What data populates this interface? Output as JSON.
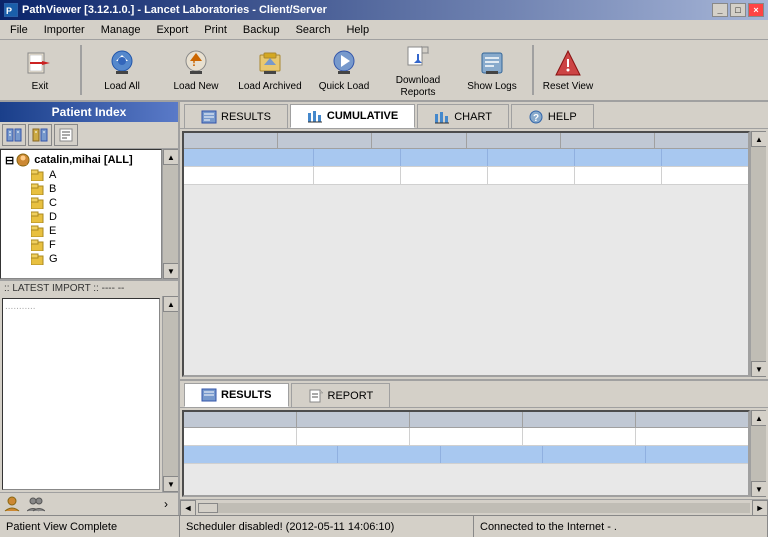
{
  "titlebar": {
    "title": "PathViewer [3.12.1.0.] - Lancet Laboratories - Client/Server",
    "icon": "PV",
    "controls": [
      "_",
      "□",
      "×"
    ]
  },
  "menubar": {
    "items": [
      "File",
      "Importer",
      "Manage",
      "Export",
      "Print",
      "Backup",
      "Search",
      "Help"
    ]
  },
  "toolbar": {
    "buttons": [
      {
        "id": "exit",
        "label": "Exit"
      },
      {
        "id": "load-all",
        "label": "Load All"
      },
      {
        "id": "load-new",
        "label": "Load New"
      },
      {
        "id": "load-archived",
        "label": "Load Archived"
      },
      {
        "id": "quick-load",
        "label": "Quick Load"
      },
      {
        "id": "download-reports",
        "label": "Download Reports"
      },
      {
        "id": "show-logs",
        "label": "Show Logs"
      },
      {
        "id": "reset-view",
        "label": "Reset View"
      }
    ]
  },
  "leftpanel": {
    "header": "Patient Index",
    "treeRoot": "catalin,mihai [ALL]",
    "treeChildren": [
      "A",
      "B",
      "C",
      "D",
      "E",
      "F",
      "G"
    ],
    "latestImport": ":: LATEST IMPORT :: ---- --",
    "bottomBtns": [
      "👤",
      "👥",
      ">"
    ]
  },
  "toptabs": {
    "tabs": [
      {
        "id": "results",
        "label": "RESULTS",
        "active": false
      },
      {
        "id": "cumulative",
        "label": "CUMULATIVE",
        "active": true
      },
      {
        "id": "chart",
        "label": "CHART",
        "active": false
      },
      {
        "id": "help",
        "label": "HELP",
        "active": false
      }
    ]
  },
  "bottomtabs": {
    "tabs": [
      {
        "id": "results",
        "label": "RESULTS",
        "active": true
      },
      {
        "id": "report",
        "label": "REPORT",
        "active": false
      }
    ]
  },
  "statusbar": {
    "left": "Patient View Complete",
    "middle": "Scheduler disabled! (2012-05-11 14:06:10)",
    "right": "Connected to the Internet - ."
  }
}
